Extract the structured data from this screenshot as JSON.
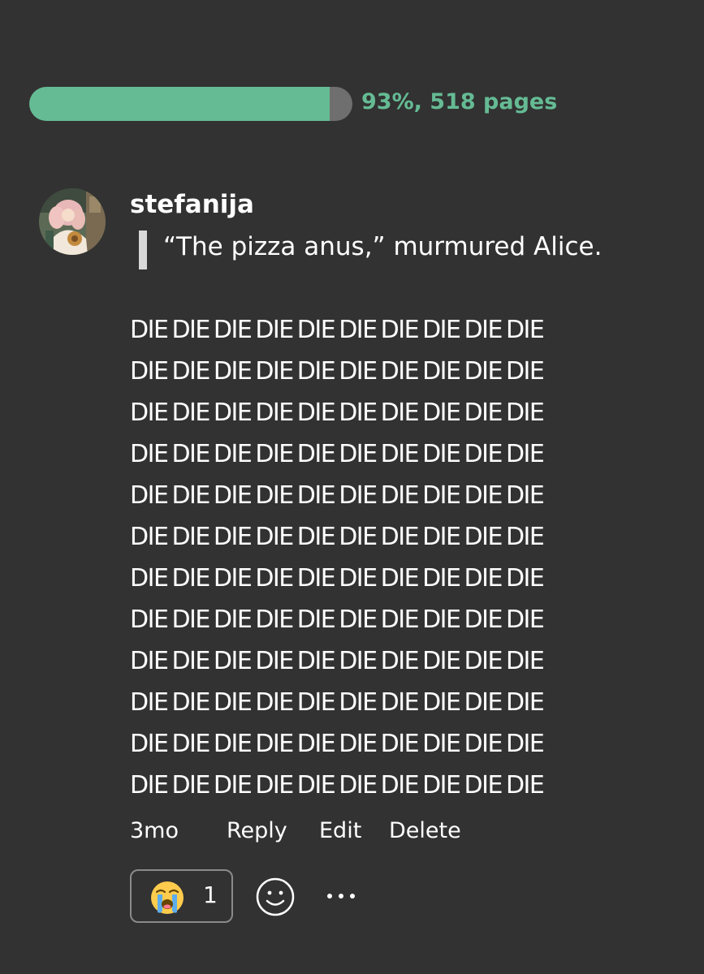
{
  "progress": {
    "percent": 93,
    "label": "93%, 518 pages",
    "fill_color": "#65bb94",
    "track_color": "#6f6f6f"
  },
  "comment": {
    "avatar_icon": "user-avatar",
    "username": "stefanija",
    "quote": "“The pizza anus,” murmured Alice.",
    "body_lines": [
      "DIE DIE DIE DIE DIE DIE DIE DIE DIE DIE",
      "DIE DIE DIE DIE DIE DIE DIE DIE DIE DIE",
      "DIE DIE DIE DIE DIE DIE DIE DIE DIE DIE",
      "DIE DIE DIE DIE DIE DIE DIE DIE DIE DIE",
      "DIE DIE DIE DIE DIE DIE DIE DIE DIE DIE",
      "DIE DIE DIE DIE DIE DIE DIE DIE DIE DIE",
      "DIE DIE DIE DIE DIE DIE DIE DIE DIE DIE",
      "DIE DIE DIE DIE DIE DIE DIE DIE DIE DIE",
      "DIE DIE DIE DIE DIE DIE DIE DIE DIE DIE",
      "DIE DIE DIE DIE DIE DIE DIE DIE DIE DIE",
      "DIE DIE DIE DIE DIE DIE DIE DIE DIE DIE",
      "DIE DIE DIE DIE DIE DIE DIE DIE DIE DIE"
    ],
    "timestamp": "3mo",
    "actions": {
      "reply": "Reply",
      "edit": "Edit",
      "delete": "Delete"
    },
    "reactions": [
      {
        "icon": "loudly-crying-face-emoji",
        "count": "1"
      }
    ],
    "add_reaction_icon": "smiley-face-icon",
    "more_icon": "ellipsis-icon"
  },
  "colors": {
    "background": "#323232",
    "accent": "#65bb94",
    "text": "#ffffff"
  }
}
